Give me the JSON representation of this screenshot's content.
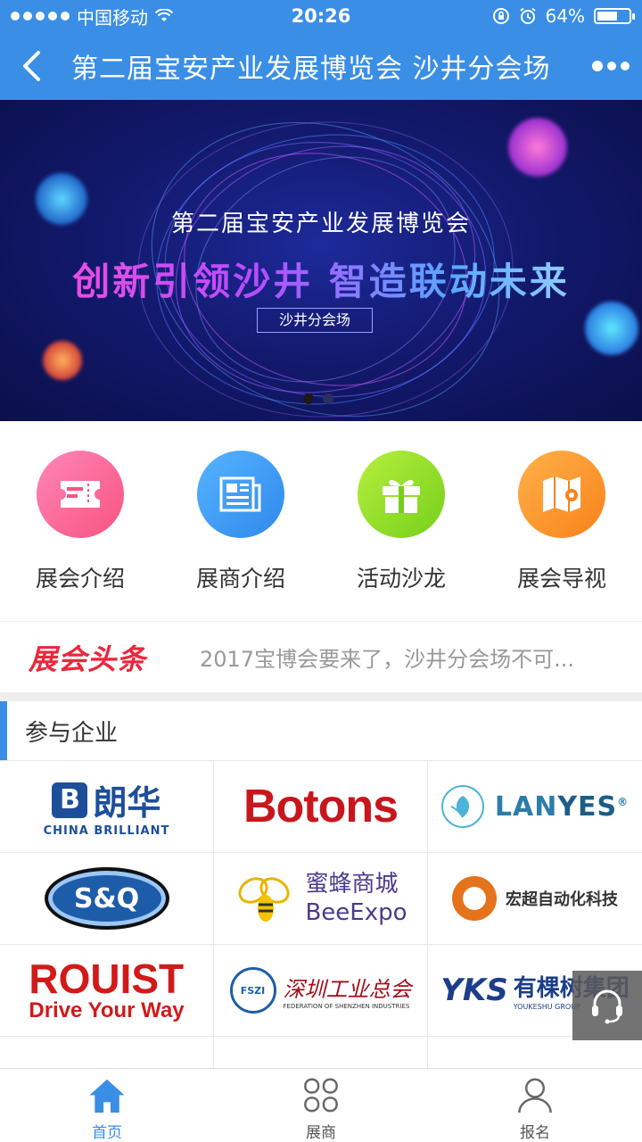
{
  "status_bar": {
    "carrier": "中国移动",
    "time": "20:26",
    "battery": "64%",
    "battery_level": 0.64
  },
  "nav": {
    "title": "第二届宝安产业发展博览会 沙井分会场"
  },
  "banner": {
    "title": "第二届宝安产业发展博览会",
    "slogan": "创新引领沙井  智造联动未来",
    "tag": "沙井分会场",
    "slides": 2,
    "active_slide": 1
  },
  "features": [
    {
      "label": "展会介绍",
      "icon": "ticket-icon",
      "color": "#f7547f"
    },
    {
      "label": "展商介绍",
      "icon": "newspaper-icon",
      "color": "#2f88ec"
    },
    {
      "label": "活动沙龙",
      "icon": "gift-icon",
      "color": "#76cf1b"
    },
    {
      "label": "展会导视",
      "icon": "map-icon",
      "color": "#f9821a"
    }
  ],
  "headline": {
    "logo": "展会头条",
    "text": "2017宝博会要来了，沙井分会场不可..."
  },
  "section": {
    "title": "参与企业"
  },
  "companies": {
    "langhua": {
      "name": "朗华",
      "sub": "CHINA BRILLIANT",
      "mark": "B"
    },
    "botons": "Botons",
    "lanyes": {
      "a": "LAN",
      "b": "YES",
      "reg": "®"
    },
    "sq": "S&Q",
    "bee": {
      "cn": "蜜蜂商城",
      "en": "BeeExpo"
    },
    "hongchao": "宏超自动化科技",
    "rouist": {
      "name": "ROUIST",
      "slogan": "Drive Your Way"
    },
    "fszi": {
      "seal": "FSZI",
      "cn": "深圳工业总会",
      "en": "FEDERATION OF SHENZHEN INDUSTRIES"
    },
    "yks": {
      "mark": "YKS",
      "cn": "有棵树集团",
      "en": "YOUKESHU GROUP"
    }
  },
  "tabs": [
    {
      "label": "首页",
      "icon": "home-icon",
      "active": true
    },
    {
      "label": "展商",
      "icon": "grid-icon",
      "active": false
    },
    {
      "label": "报名",
      "icon": "user-icon",
      "active": false
    }
  ],
  "colors": {
    "primary": "#3a8ee6",
    "headline_red": "#e8283d"
  }
}
